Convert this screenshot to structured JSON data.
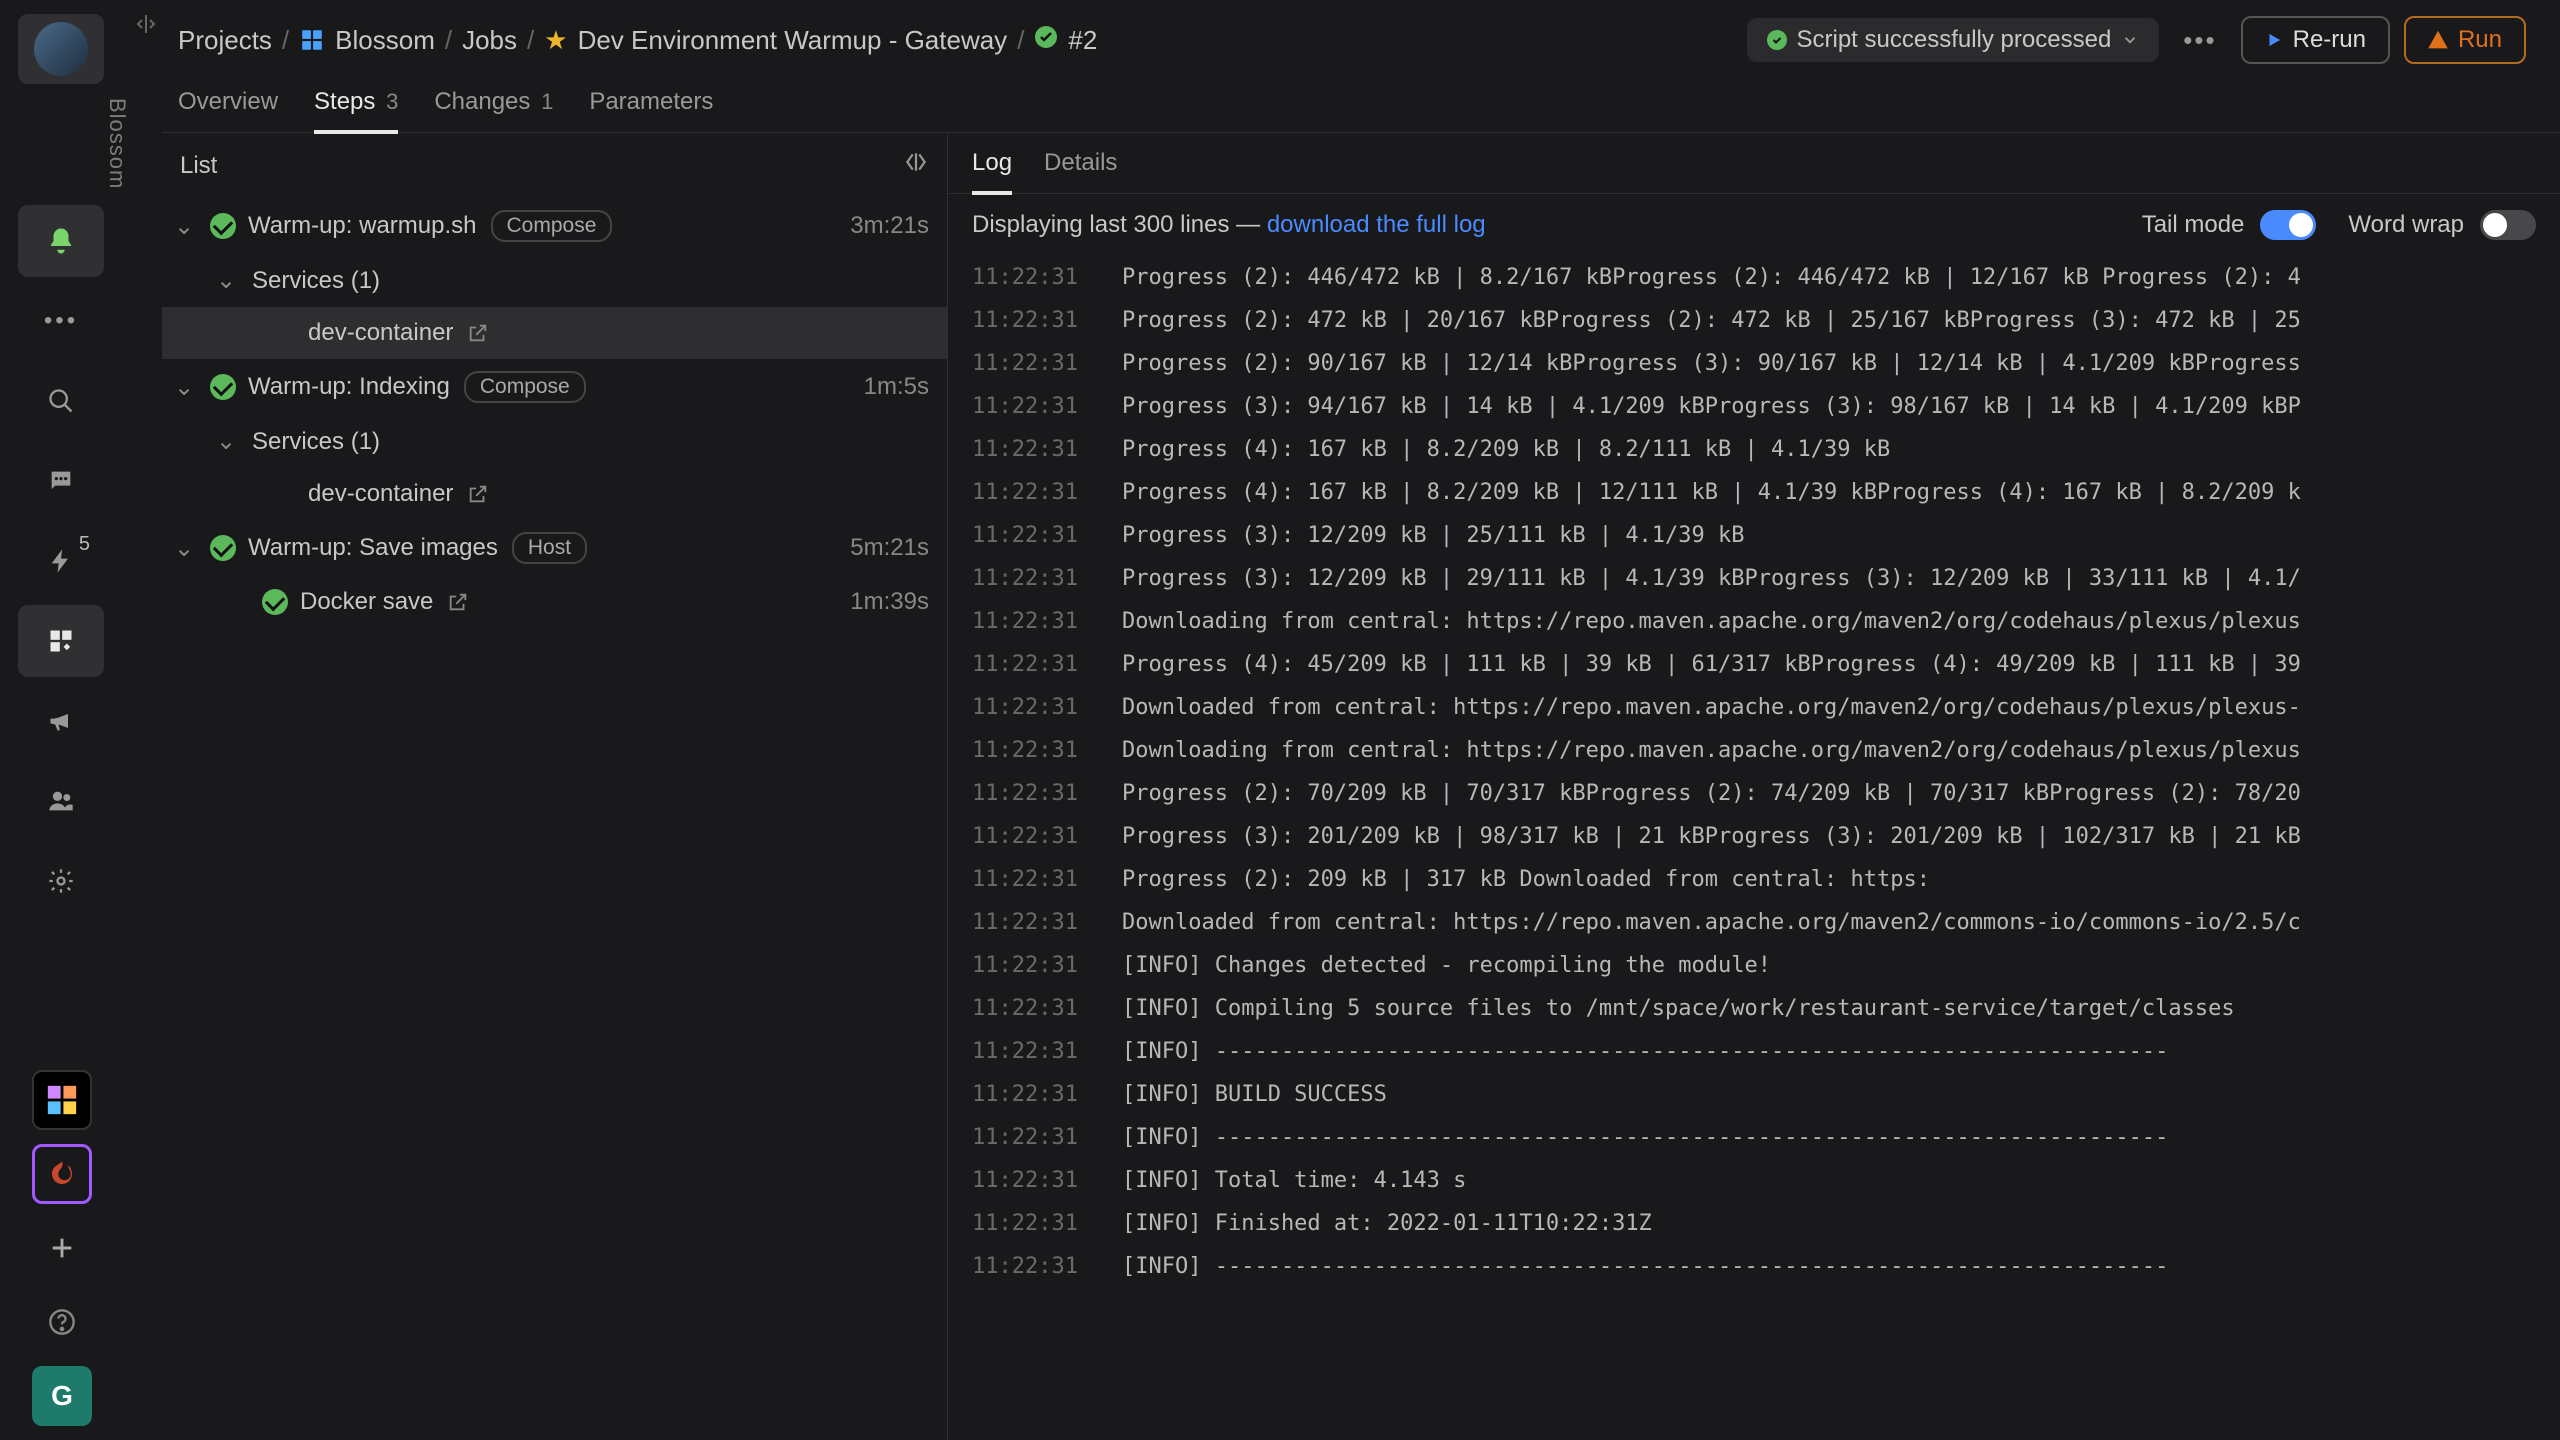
{
  "rail": {
    "org": "Blossom",
    "badge": "5",
    "bottom_g": "G"
  },
  "breadcrumbs": {
    "projects": "Projects",
    "project": "Blossom",
    "jobs": "Jobs",
    "job": "Dev Environment Warmup - Gateway",
    "run": "#2"
  },
  "header": {
    "status": "Script successfully processed",
    "rerun": "Re-run",
    "run": "Run"
  },
  "tabs": {
    "overview": "Overview",
    "steps": "Steps",
    "steps_count": "3",
    "changes": "Changes",
    "changes_count": "1",
    "parameters": "Parameters"
  },
  "list": {
    "header": "List",
    "services_label": "Services (1)",
    "tag_compose": "Compose",
    "tag_host": "Host",
    "steps": [
      {
        "name": "Warm-up: warmup.sh",
        "time": "3m:21s"
      },
      {
        "name": "Warm-up: Indexing",
        "time": "1m:5s"
      },
      {
        "name": "Warm-up: Save images",
        "time": "5m:21s"
      }
    ],
    "dev_container": "dev-container",
    "docker_save": "Docker save",
    "docker_save_time": "1m:39s"
  },
  "log_tabs": {
    "log": "Log",
    "details": "Details"
  },
  "log_bar": {
    "prefix": "Displaying last 300 lines — ",
    "link": "download the full log",
    "tail": "Tail mode",
    "wrap": "Word wrap"
  },
  "log_lines": [
    {
      "t": "11:22:31",
      "m": "Progress (2): 446/472 kB | 8.2/167 kBProgress (2): 446/472 kB | 12/167 kB Progress (2): 4"
    },
    {
      "t": "11:22:31",
      "m": "Progress (2): 472 kB | 20/167 kBProgress (2): 472 kB | 25/167 kBProgress (3): 472 kB | 25"
    },
    {
      "t": "11:22:31",
      "m": "Progress (2): 90/167 kB | 12/14 kBProgress (3): 90/167 kB | 12/14 kB | 4.1/209 kBProgress"
    },
    {
      "t": "11:22:31",
      "m": "Progress (3): 94/167 kB | 14 kB | 4.1/209 kBProgress (3): 98/167 kB | 14 kB | 4.1/209 kBP"
    },
    {
      "t": "11:22:31",
      "m": "Progress (4): 167 kB | 8.2/209 kB | 8.2/111 kB | 4.1/39 kB"
    },
    {
      "t": "11:22:31",
      "m": "Progress (4): 167 kB | 8.2/209 kB | 12/111 kB | 4.1/39 kBProgress (4): 167 kB | 8.2/209 k"
    },
    {
      "t": "11:22:31",
      "m": "Progress (3): 12/209 kB | 25/111 kB | 4.1/39 kB"
    },
    {
      "t": "11:22:31",
      "m": "Progress (3): 12/209 kB | 29/111 kB | 4.1/39 kBProgress (3): 12/209 kB | 33/111 kB | 4.1/"
    },
    {
      "t": "11:22:31",
      "m": "Downloading from central: https://repo.maven.apache.org/maven2/org/codehaus/plexus/plexus"
    },
    {
      "t": "11:22:31",
      "m": "Progress (4): 45/209 kB | 111 kB | 39 kB | 61/317 kBProgress (4): 49/209 kB | 111 kB | 39"
    },
    {
      "t": "11:22:31",
      "m": "Downloaded from central: https://repo.maven.apache.org/maven2/org/codehaus/plexus/plexus-"
    },
    {
      "t": "11:22:31",
      "m": "Downloading from central: https://repo.maven.apache.org/maven2/org/codehaus/plexus/plexus"
    },
    {
      "t": "11:22:31",
      "m": "Progress (2): 70/209 kB | 70/317 kBProgress (2): 74/209 kB | 70/317 kBProgress (2): 78/20"
    },
    {
      "t": "11:22:31",
      "m": "Progress (3): 201/209 kB | 98/317 kB | 21 kBProgress (3): 201/209 kB | 102/317 kB | 21 kB"
    },
    {
      "t": "11:22:31",
      "m": "Progress (2): 209 kB | 317 kB                                              Downloaded from central: https:"
    },
    {
      "t": "11:22:31",
      "m": "Downloaded from central: https://repo.maven.apache.org/maven2/commons-io/commons-io/2.5/c"
    },
    {
      "t": "11:22:31",
      "m": "[INFO] Changes detected - recompiling the module!"
    },
    {
      "t": "11:22:31",
      "m": "[INFO] Compiling 5 source files to /mnt/space/work/restaurant-service/target/classes"
    },
    {
      "t": "11:22:31",
      "m": "[INFO] ------------------------------------------------------------------------"
    },
    {
      "t": "11:22:31",
      "m": "[INFO] BUILD SUCCESS"
    },
    {
      "t": "11:22:31",
      "m": "[INFO] ------------------------------------------------------------------------"
    },
    {
      "t": "11:22:31",
      "m": "[INFO] Total time:  4.143 s"
    },
    {
      "t": "11:22:31",
      "m": "[INFO] Finished at: 2022-01-11T10:22:31Z"
    },
    {
      "t": "11:22:31",
      "m": "[INFO] ------------------------------------------------------------------------"
    }
  ]
}
